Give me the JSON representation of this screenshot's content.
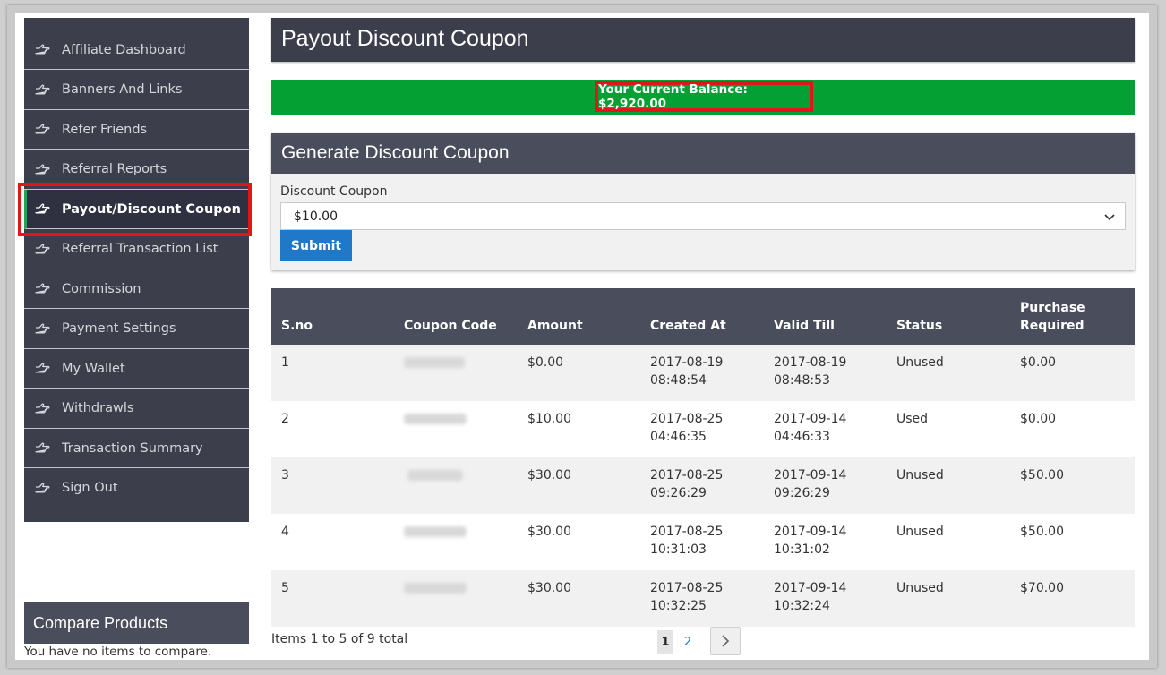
{
  "sidebar": {
    "items": [
      {
        "label": "Affiliate Dashboard"
      },
      {
        "label": "Banners And Links"
      },
      {
        "label": "Refer Friends"
      },
      {
        "label": "Referral Reports"
      },
      {
        "label": "Payout/Discount Coupon",
        "active": true
      },
      {
        "label": "Referral Transaction List"
      },
      {
        "label": "Commission"
      },
      {
        "label": "Payment Settings"
      },
      {
        "label": "My Wallet"
      },
      {
        "label": "Withdrawls"
      },
      {
        "label": "Transaction Summary"
      },
      {
        "label": "Sign Out"
      }
    ],
    "icon": "hand-pointing-right-icon"
  },
  "compare": {
    "title": "Compare Products",
    "empty_text": "You have no items to compare."
  },
  "page": {
    "title": "Payout Discount Coupon",
    "balance": "Your Current Balance: $2,920.00"
  },
  "generator": {
    "heading": "Generate Discount Coupon",
    "label": "Discount Coupon",
    "selected": "$10.00",
    "submit_label": "Submit"
  },
  "table": {
    "headers": [
      "S.no",
      "Coupon Code",
      "Amount",
      "Created At",
      "Valid Till",
      "Status",
      "Purchase Required"
    ],
    "rows": [
      {
        "sno": "1",
        "amount": "$0.00",
        "created_date": "2017-08-19",
        "created_time": "08:48:54",
        "valid_date": "2017-08-19",
        "valid_time": "08:48:53",
        "status": "Unused",
        "purchase": "$0.00"
      },
      {
        "sno": "2",
        "amount": "$10.00",
        "created_date": "2017-08-25",
        "created_time": "04:46:35",
        "valid_date": "2017-09-14",
        "valid_time": "04:46:33",
        "status": "Used",
        "purchase": "$0.00"
      },
      {
        "sno": "3",
        "amount": "$30.00",
        "created_date": "2017-08-25",
        "created_time": "09:26:29",
        "valid_date": "2017-09-14",
        "valid_time": "09:26:29",
        "status": "Unused",
        "purchase": "$50.00"
      },
      {
        "sno": "4",
        "amount": "$30.00",
        "created_date": "2017-08-25",
        "created_time": "10:31:03",
        "valid_date": "2017-09-14",
        "valid_time": "10:31:02",
        "status": "Unused",
        "purchase": "$50.00"
      },
      {
        "sno": "5",
        "amount": "$30.00",
        "created_date": "2017-08-25",
        "created_time": "10:32:25",
        "valid_date": "2017-09-14",
        "valid_time": "10:32:24",
        "status": "Unused",
        "purchase": "$70.00"
      }
    ]
  },
  "pager": {
    "summary": "Items 1 to 5 of 9 total",
    "current": "1",
    "next_page": "2"
  },
  "colors": {
    "sidebar_bg": "#3c3e4c",
    "balance_bg": "#04a034",
    "highlight": "#e0161b",
    "button": "#1f79c8"
  }
}
